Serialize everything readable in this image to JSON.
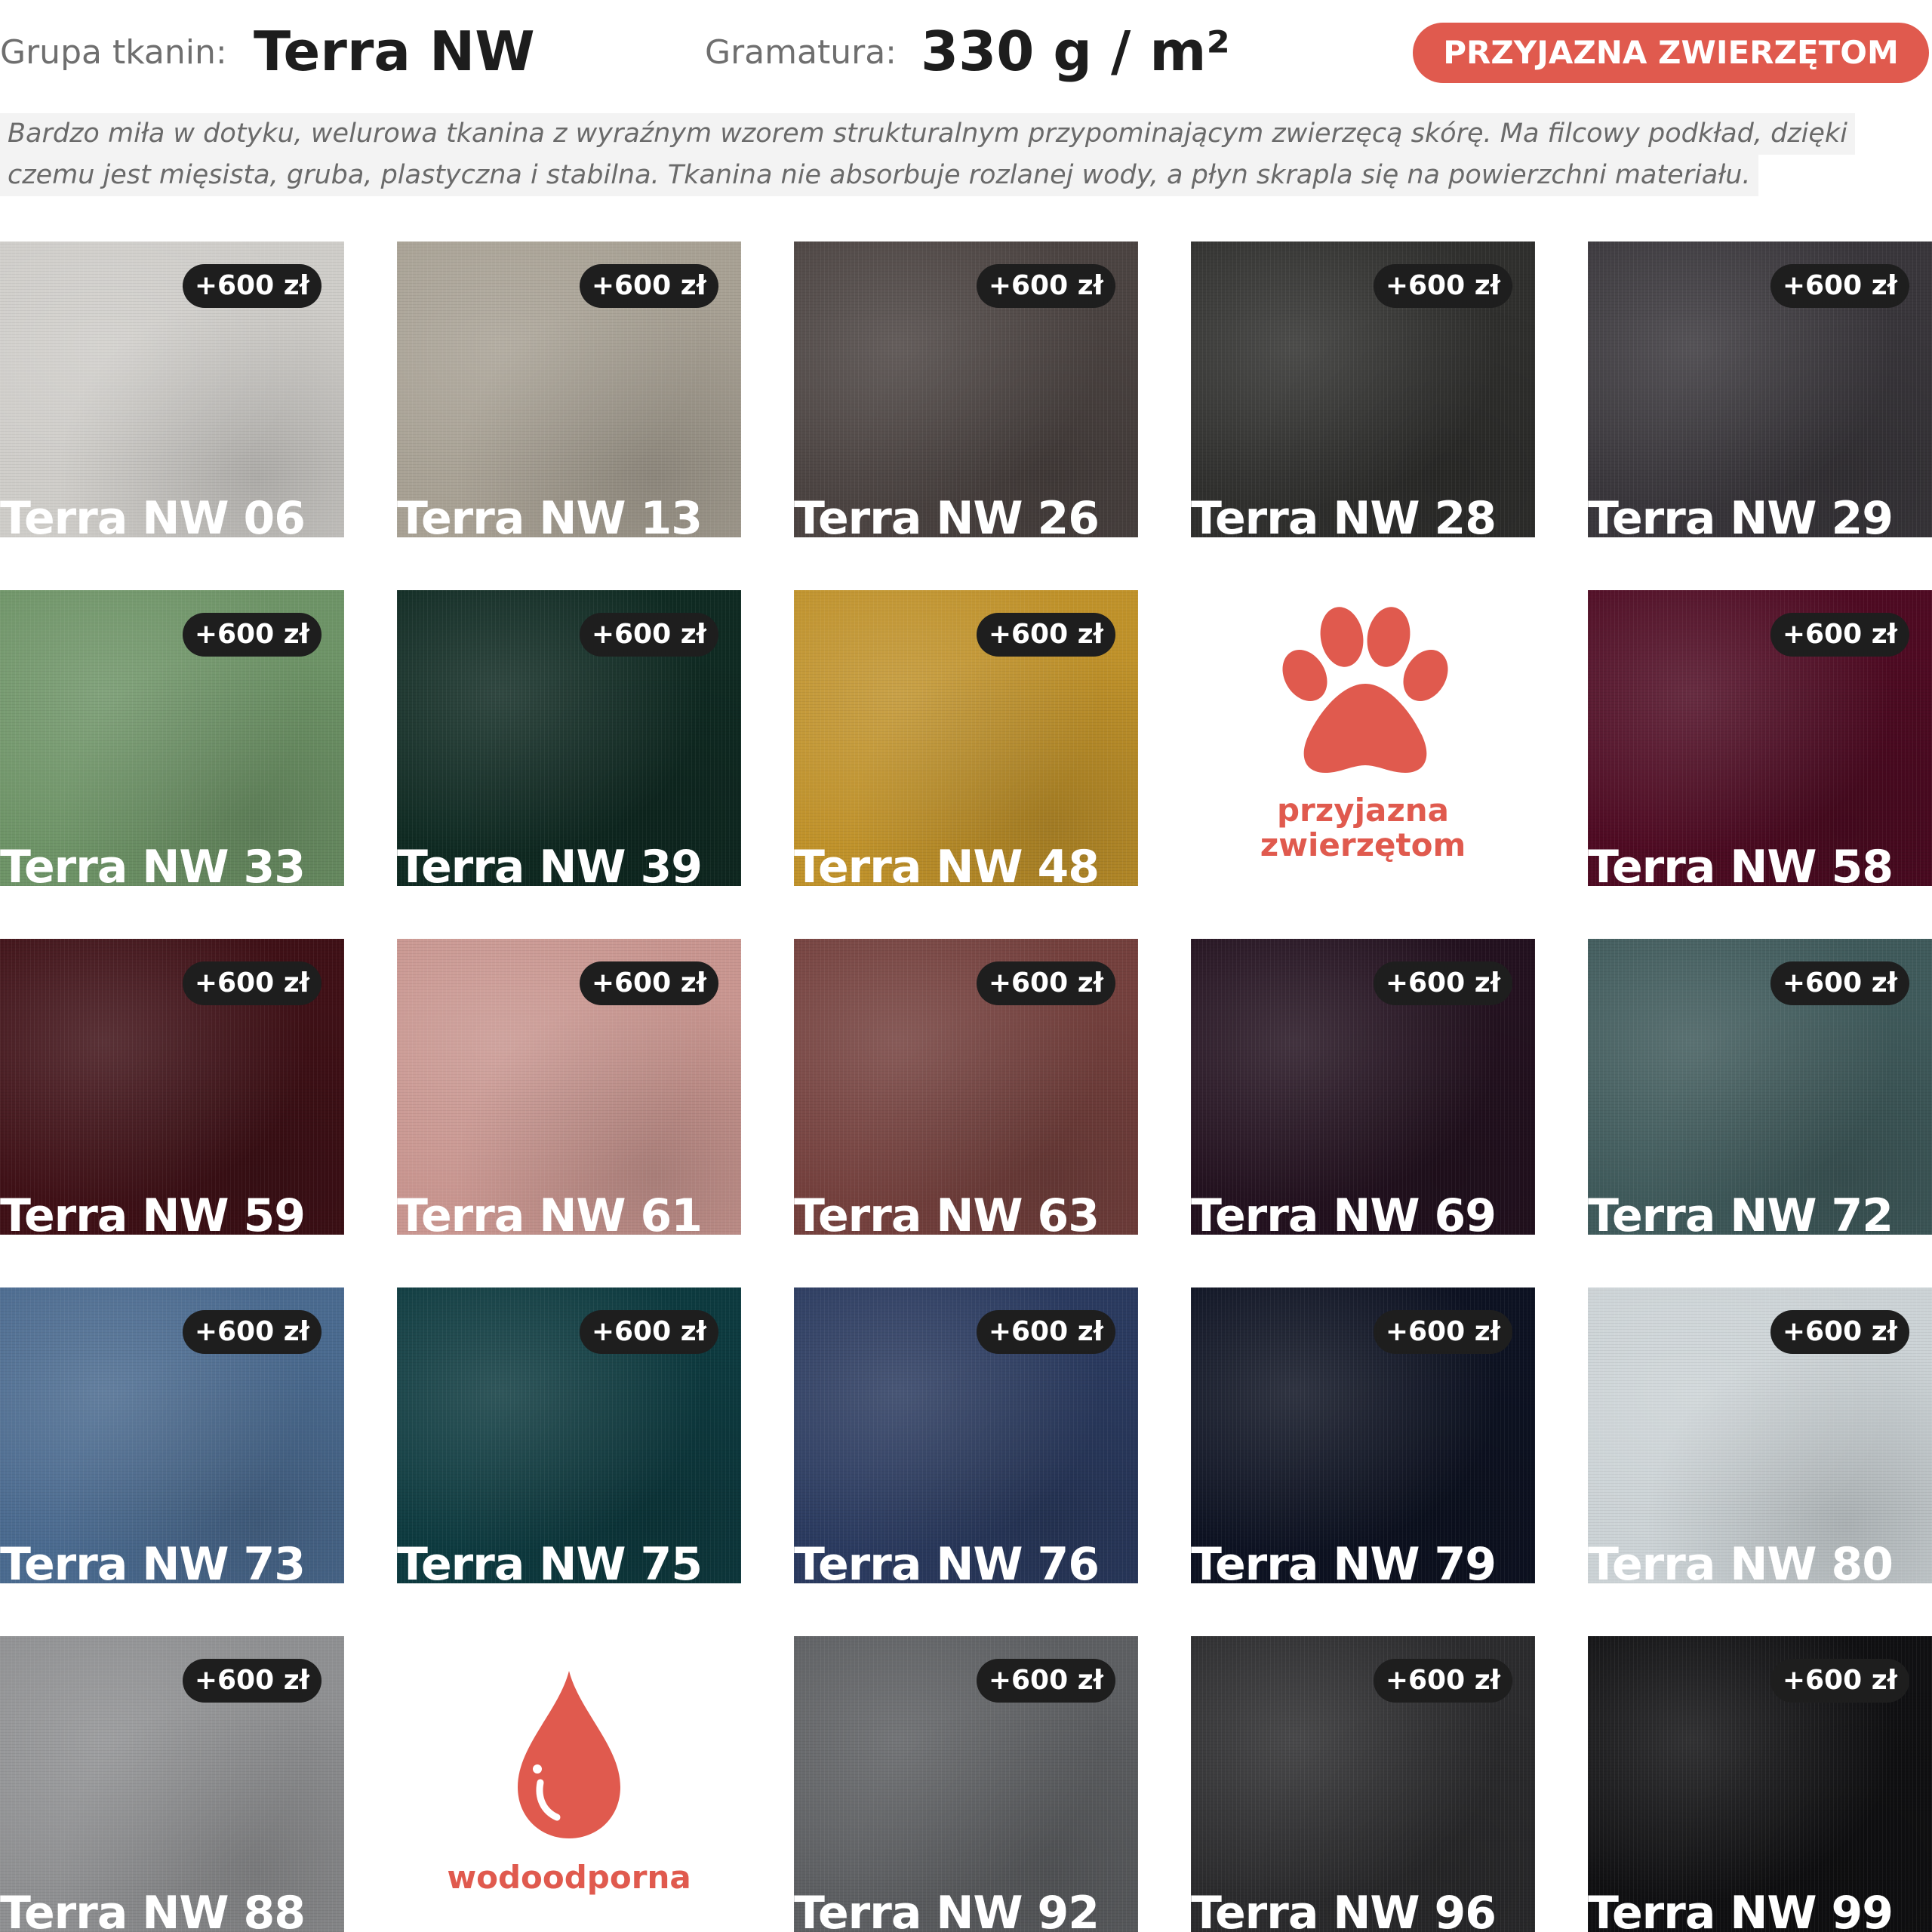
{
  "header": {
    "group_label": "Grupa tkanin:",
    "group_value": "Terra NW",
    "weight_label": "Gramatura:",
    "weight_value": "330 g / m²",
    "badge": "PRZYJAZNA ZWIERZĘTOM"
  },
  "description": {
    "line1": "Bardzo miła w dotyku, welurowa tkanina z wyraźnym wzorem strukturalnym przypominającym zwierzęcą skórę. Ma filcowy podkład, dzięki",
    "line2": "czemu jest mięsista, gruba, plastyczna i stabilna. Tkanina nie absorbuje rozlanej wody, a płyn skrapla się na powierzchni materiału."
  },
  "price": "+600 zł",
  "swatches": [
    {
      "name": "Terra NW 06",
      "color": "#cfcdc9"
    },
    {
      "name": "Terra NW 13",
      "color": "#a8a194"
    },
    {
      "name": "Terra NW 26",
      "color": "#4b4341"
    },
    {
      "name": "Terra NW 28",
      "color": "#2f2f2d"
    },
    {
      "name": "Terra NW 29",
      "color": "#39363b"
    },
    {
      "name": "Terra NW 33",
      "color": "#6e9467"
    },
    {
      "name": "Terra NW 39",
      "color": "#0f2a22"
    },
    {
      "name": "Terra NW 48",
      "color": "#c0922a"
    },
    {
      "name": "Terra NW 58",
      "color": "#4e0a22"
    },
    {
      "name": "Terra NW 59",
      "color": "#3f1016"
    },
    {
      "name": "Terra NW 61",
      "color": "#c99690"
    },
    {
      "name": "Terra NW 63",
      "color": "#74403d"
    },
    {
      "name": "Terra NW 69",
      "color": "#23111f"
    },
    {
      "name": "Terra NW 72",
      "color": "#3f5a5b"
    },
    {
      "name": "Terra NW 73",
      "color": "#4a6a8f"
    },
    {
      "name": "Terra NW 75",
      "color": "#0d3a3f"
    },
    {
      "name": "Terra NW 76",
      "color": "#2a3a5f"
    },
    {
      "name": "Terra NW 79",
      "color": "#0d1222"
    },
    {
      "name": "Terra NW 80",
      "color": "#ccd3d6"
    },
    {
      "name": "Terra NW 88",
      "color": "#8f9092"
    },
    {
      "name": "Terra NW 92",
      "color": "#5d5f62"
    },
    {
      "name": "Terra NW 96",
      "color": "#2b2b2d"
    },
    {
      "name": "Terra NW 99",
      "color": "#101012"
    }
  ],
  "features": {
    "pet_line1": "przyjazna",
    "pet_line2": "zwierzętom",
    "water": "wodoodporna",
    "accent_color": "#e05a4e"
  }
}
